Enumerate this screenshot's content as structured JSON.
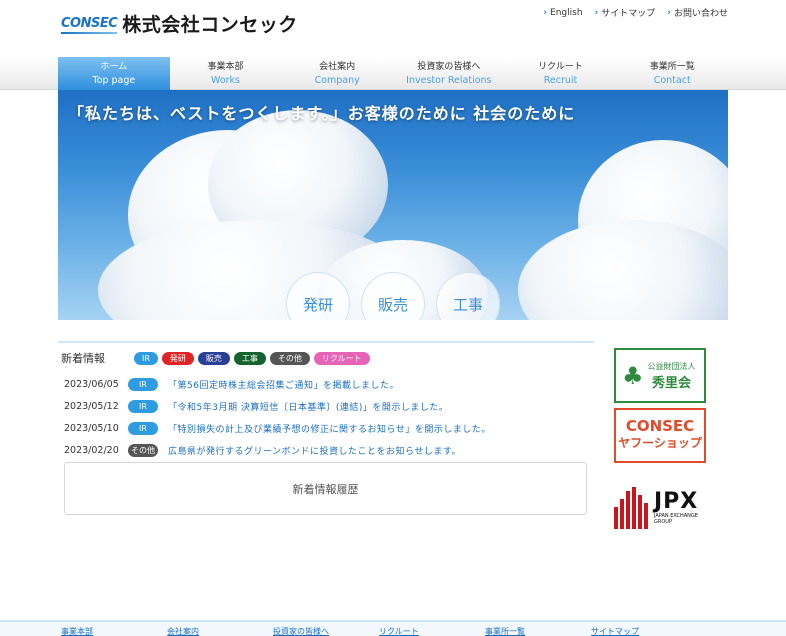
{
  "header": {
    "logo_mark": "CONSEC",
    "logo_text": "株式会社コンセック",
    "links": [
      {
        "label": "English"
      },
      {
        "label": "サイトマップ"
      },
      {
        "label": "お問い合わせ"
      }
    ]
  },
  "nav": [
    {
      "jp": "ホーム",
      "en": "Top page",
      "active": true
    },
    {
      "jp": "事業本部",
      "en": "Works"
    },
    {
      "jp": "会社案内",
      "en": "Company"
    },
    {
      "jp": "投資家の皆様へ",
      "en": "Investor Relations"
    },
    {
      "jp": "リクルート",
      "en": "Recruit"
    },
    {
      "jp": "事業所一覧",
      "en": "Contact"
    }
  ],
  "hero": {
    "title": "「私たちは、ベストをつくします。」お客様のために 社会のために",
    "circles": [
      "発研",
      "販売",
      "工事"
    ]
  },
  "news": {
    "title": "新着情報",
    "filters": [
      "IR",
      "発研",
      "販売",
      "工事",
      "その他",
      "リクルート"
    ],
    "items": [
      {
        "date": "2023/06/05",
        "tag": "IR",
        "text": "「第56回定時株主総会招集ご通知」を掲載しました。"
      },
      {
        "date": "2023/05/12",
        "tag": "IR",
        "text": "「令和5年3月期 決算短信〔日本基準〕(連結)」を開示しました。"
      },
      {
        "date": "2023/05/10",
        "tag": "IR",
        "text": "「特別損失の計上及び業績予想の修正に関するお知らせ」を開示しました。"
      },
      {
        "date": "2023/02/20",
        "tag": "その他",
        "text": "広島県が発行するグリーンボンドに投資したことをお知らせします。"
      }
    ],
    "history_button": "新着情報履歴"
  },
  "banners": {
    "shuri": {
      "line1": "公益財団法人",
      "line2": "秀里会"
    },
    "yahoo": {
      "line1": "CONSEC",
      "line2": "ヤフーショップ"
    },
    "jpx": {
      "line1": "JPX",
      "line2": "JAPAN EXCHANGE",
      "line3": "GROUP"
    }
  },
  "footer": {
    "links": [
      "事業本部",
      "会社案内",
      "投資家の皆様へ",
      "リクルート",
      "事業所一覧",
      "サイトマップ"
    ]
  },
  "colors": {
    "accent": "#1a73c8",
    "ir": "#2f9be0",
    "dev": "#e02424",
    "sale": "#2a3f96",
    "work": "#17632f",
    "other": "#555555",
    "recruit": "#e664b6"
  }
}
